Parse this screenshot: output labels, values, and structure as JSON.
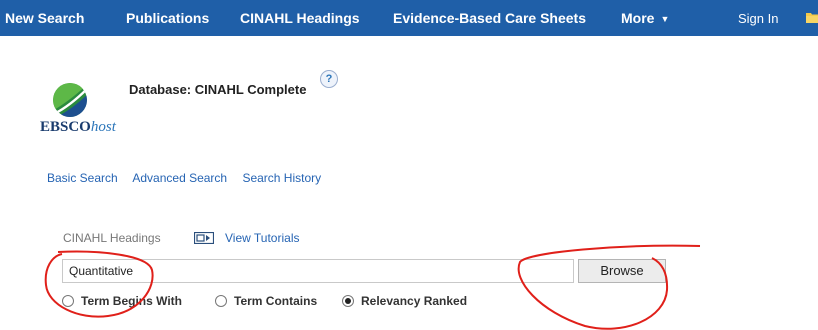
{
  "topnav": {
    "items": [
      {
        "label": "New Search"
      },
      {
        "label": "Publications"
      },
      {
        "label": "CINAHL Headings"
      },
      {
        "label": "Evidence-Based Care Sheets"
      },
      {
        "label": "More"
      }
    ],
    "signin": "Sign In",
    "bg_color": "#1f5fa8"
  },
  "logo": {
    "brand": "EBSCO",
    "brand_suffix": "host"
  },
  "database": {
    "label": "Database: CINAHL Complete",
    "help": "?"
  },
  "search_links": [
    "Basic Search",
    "Advanced Search",
    "Search History"
  ],
  "headings": {
    "label": "CINAHL Headings",
    "tutorial_label": "View Tutorials"
  },
  "search": {
    "value": "Quantitative",
    "browse_label": "Browse"
  },
  "radio_options": [
    {
      "label": "Term Begins With",
      "checked": false
    },
    {
      "label": "Term Contains",
      "checked": false
    },
    {
      "label": "Relevancy Ranked",
      "checked": true
    }
  ],
  "annotation_color": "#e0201a"
}
